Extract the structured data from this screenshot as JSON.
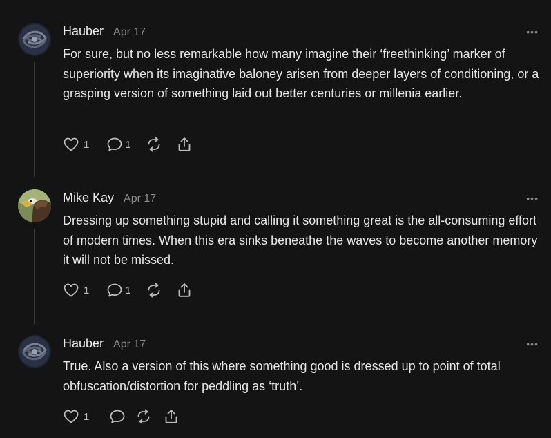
{
  "comments": [
    {
      "author": "Hauber",
      "date": "Apr 17",
      "avatar": "galaxy-avatar",
      "text": "For sure, but no less remarkable how many imagine their ‘freethinking’ marker of superiority when its imaginative baloney arisen from deeper layers of conditioning, or a grasping version of something laid out better centuries or millenia earlier.",
      "likes": "1",
      "replies": "1"
    },
    {
      "author": "Mike Kay",
      "date": "Apr 17",
      "avatar": "eagle-avatar",
      "text": "Dressing up something stupid and calling it something great is the all-consuming effort of modern times. When this era sinks beneathe the waves to become another memory it will not be missed.",
      "likes": "1",
      "replies": "1"
    },
    {
      "author": "Hauber",
      "date": "Apr 17",
      "avatar": "galaxy-avatar",
      "text": "True. Also a version of this where something good is dressed up to point of total obfuscation/distortion for peddling as ‘truth’.",
      "likes": "1",
      "replies": ""
    }
  ],
  "icons": {
    "more": "ellipsis-icon",
    "like": "heart-icon",
    "reply": "comment-bubble-icon",
    "restack": "restack-icon",
    "share": "share-icon"
  },
  "colors": {
    "background": "#141414",
    "text": "#e6e6e6",
    "muted": "#8b8b8b"
  }
}
